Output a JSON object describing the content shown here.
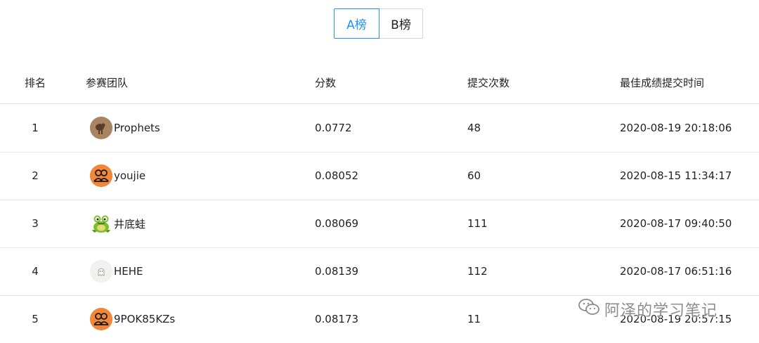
{
  "tabs": [
    {
      "label": "A榜",
      "active": true
    },
    {
      "label": "B榜",
      "active": false
    }
  ],
  "columns": {
    "rank": "排名",
    "team": "参赛团队",
    "score": "分数",
    "submissions": "提交次数",
    "best_time": "最佳成绩提交时间"
  },
  "rows": [
    {
      "rank": "1",
      "team": "Prophets",
      "avatar": "wooden-figure-avatar",
      "score": "0.0772",
      "submissions": "48",
      "best_time": "2020-08-19 20:18:06"
    },
    {
      "rank": "2",
      "team": "youjie",
      "avatar": "default-team-avatar",
      "score": "0.08052",
      "submissions": "60",
      "best_time": "2020-08-15 11:34:17"
    },
    {
      "rank": "3",
      "team": "井底蛙",
      "avatar": "frog-avatar",
      "score": "0.08069",
      "submissions": "111",
      "best_time": "2020-08-17 09:40:50"
    },
    {
      "rank": "4",
      "team": "HEHE",
      "avatar": "ghost-avatar",
      "score": "0.08139",
      "submissions": "112",
      "best_time": "2020-08-17 06:51:16"
    },
    {
      "rank": "5",
      "team": "9POK85KZs",
      "avatar": "default-team-avatar",
      "score": "0.08173",
      "submissions": "11",
      "best_time": "2020-08-19 20:57:15"
    }
  ],
  "watermark": {
    "text": "阿泽的学习笔记",
    "icon": "wechat-icon"
  },
  "colors": {
    "accent": "#1e90ff",
    "avatar_orange": "#f2873a",
    "divider": "#e8e8e8"
  }
}
